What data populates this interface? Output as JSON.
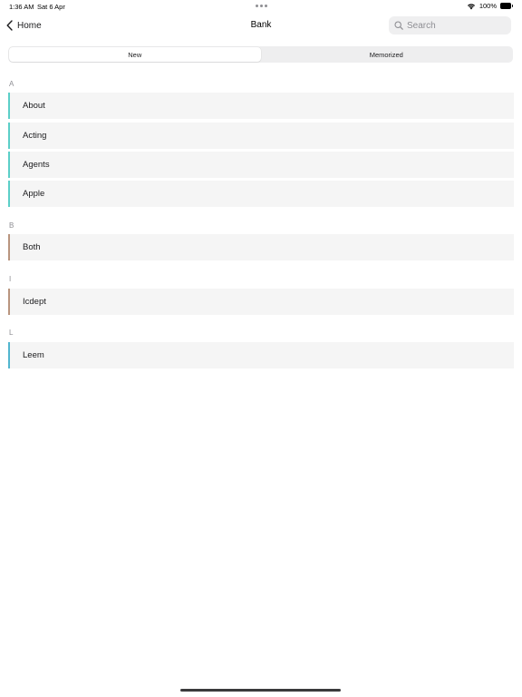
{
  "status_bar": {
    "time": "1:36 AM",
    "date": "Sat 6 Apr",
    "battery": "100%"
  },
  "nav": {
    "back_label": "Home",
    "title": "Bank",
    "search_placeholder": "Search"
  },
  "segments": {
    "new_label": "New",
    "memorized_label": "Memorized",
    "selected": "New"
  },
  "sections": [
    {
      "letter": "A",
      "accent": "#5ccfc8",
      "items": [
        "About",
        "Acting",
        "Agents",
        "Apple"
      ]
    },
    {
      "letter": "B",
      "accent": "#b9957f",
      "items": [
        "Both"
      ]
    },
    {
      "letter": "I",
      "accent": "#b9957f",
      "items": [
        "Icdept"
      ]
    },
    {
      "letter": "L",
      "accent": "#52b6cf",
      "items": [
        "Leem"
      ]
    }
  ],
  "colors": {
    "row_background": "#f5f5f5",
    "segment_track": "#eeeeef",
    "secondary_text": "#8e8e93"
  }
}
